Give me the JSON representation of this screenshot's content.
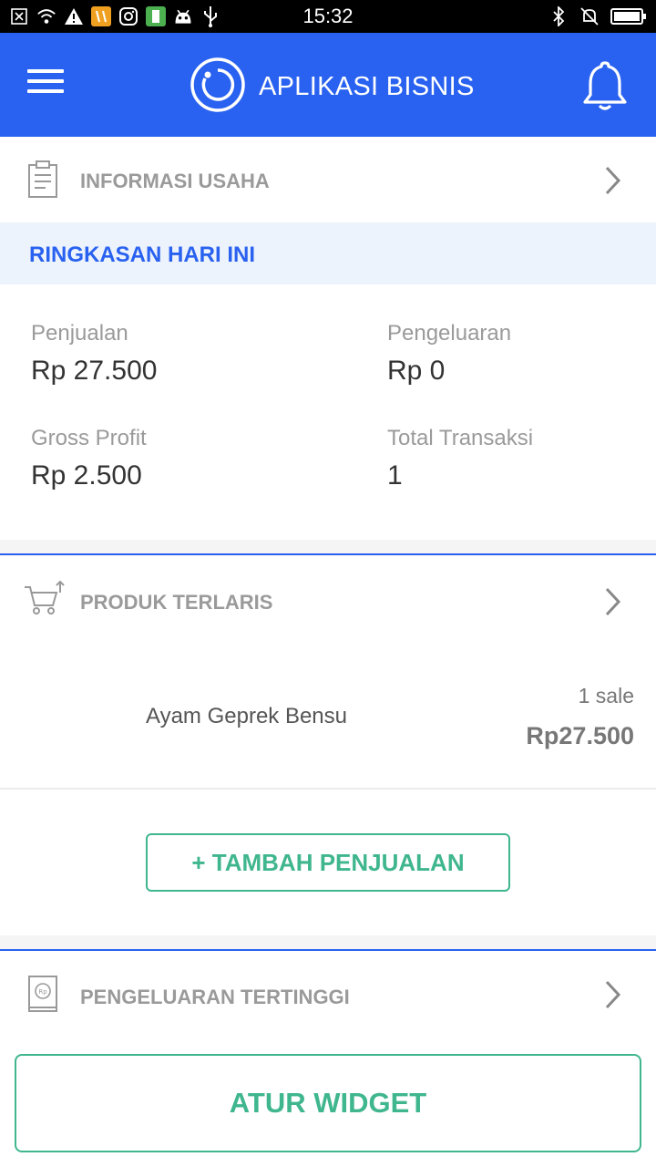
{
  "status_bar": {
    "time": "15:32",
    "icons_left": [
      "close-box-icon",
      "wifi-icon",
      "warning-icon",
      "app-orange-icon",
      "instagram-icon",
      "battery-green-icon",
      "android-icon",
      "usb-icon"
    ],
    "icons_right": [
      "bluetooth-icon",
      "mute-icon",
      "battery-icon"
    ]
  },
  "app_bar": {
    "title": "APLIKASI BISNIS",
    "color": "#2962f0"
  },
  "info_usaha": {
    "label": "INFORMASI USAHA"
  },
  "summary": {
    "header": "RINGKASAN HARI INI",
    "stats": [
      {
        "label": "Penjualan",
        "value": "Rp 27.500"
      },
      {
        "label": "Pengeluaran",
        "value": "Rp 0"
      },
      {
        "label": "Gross Profit",
        "value": "Rp 2.500"
      },
      {
        "label": "Total Transaksi",
        "value": "1"
      }
    ]
  },
  "produk_terlaris": {
    "label": "PRODUK TERLARIS",
    "items": [
      {
        "name": "Ayam Geprek Bensu",
        "sales": "1 sale",
        "price": "Rp27.500"
      }
    ],
    "add_button": "+ TAMBAH PENJUALAN"
  },
  "pengeluaran_tertinggi": {
    "label": "PENGELUARAN TERTINGGI"
  },
  "footer": {
    "widget_button": "ATUR WIDGET"
  },
  "colors": {
    "primary": "#2962f0",
    "accent_green": "#3fb68e",
    "muted_text": "#9a9a9a"
  }
}
